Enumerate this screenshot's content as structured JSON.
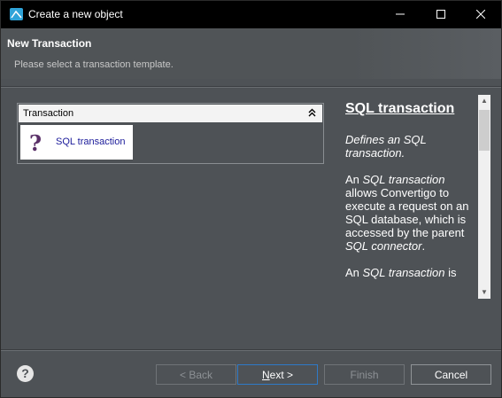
{
  "window": {
    "title": "Create a new object",
    "minimize_icon": "minimize-icon",
    "maximize_icon": "maximize-icon",
    "close_icon": "close-icon"
  },
  "header": {
    "title": "New Transaction",
    "subtitle": "Please select a transaction template."
  },
  "tree": {
    "header_label": "Transaction",
    "items": [
      {
        "label": "SQL transaction",
        "icon": "question-mark-icon"
      }
    ]
  },
  "description": {
    "title": "SQL transaction",
    "para1": "Defines an SQL transaction.",
    "para2": "An SQL transaction allows Convertigo to execute a request on an SQL database, which is accessed by the parent SQL connector.",
    "para3": "An SQL transaction is"
  },
  "buttons": {
    "back": "< Back",
    "next": "Next >",
    "finish": "Finish",
    "cancel": "Cancel"
  },
  "colors": {
    "background": "#4e5256",
    "titlebar": "#000000",
    "accent_blue": "#2fa3d8"
  }
}
